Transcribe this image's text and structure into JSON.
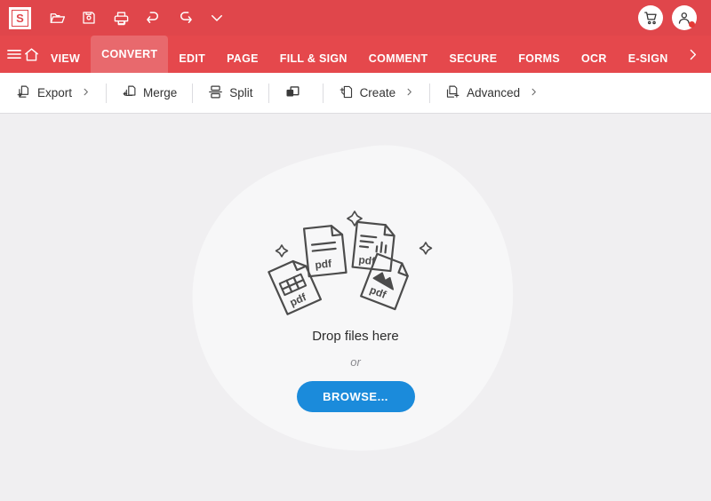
{
  "app": {
    "logo_letter": "S",
    "brand_red": "#e0464b",
    "nav_red": "#e5484c",
    "active_tab_red": "#e8696d",
    "accent_blue": "#1b8bdb",
    "canvas_bg": "#f0eff1",
    "blob_fill": "#f7f7f8"
  },
  "topbar": {
    "icons": [
      {
        "name": "open-folder-icon",
        "label": "Open"
      },
      {
        "name": "save-icon",
        "label": "Save"
      },
      {
        "name": "print-icon",
        "label": "Print"
      },
      {
        "name": "undo-icon",
        "label": "Undo"
      },
      {
        "name": "redo-icon",
        "label": "Redo"
      },
      {
        "name": "chevron-down-icon",
        "label": "More"
      }
    ],
    "right": [
      {
        "name": "cart-icon",
        "label": "Cart",
        "badge": false
      },
      {
        "name": "account-icon",
        "label": "Account",
        "badge": true
      }
    ]
  },
  "nav": {
    "menu_icon": "hamburger-menu-icon",
    "home_icon": "home-icon",
    "tabs": [
      {
        "label": "VIEW",
        "active": false
      },
      {
        "label": "CONVERT",
        "active": true
      },
      {
        "label": "EDIT",
        "active": false
      },
      {
        "label": "PAGE",
        "active": false
      },
      {
        "label": "FILL & SIGN",
        "active": false
      },
      {
        "label": "COMMENT",
        "active": false
      },
      {
        "label": "SECURE",
        "active": false
      },
      {
        "label": "FORMS",
        "active": false
      },
      {
        "label": "OCR",
        "active": false
      },
      {
        "label": "E-SIGN",
        "active": false
      }
    ],
    "overflow_icon": "chevron-right-icon",
    "help_icon": "help-circle-icon",
    "settings_icon": "gear-icon"
  },
  "toolbar": {
    "items": [
      {
        "label": "Export",
        "icon": "export-icon",
        "has_chevron": true
      },
      {
        "label": "Merge",
        "icon": "merge-icon",
        "has_chevron": false
      },
      {
        "label": "Split",
        "icon": "split-icon",
        "has_chevron": false
      },
      {
        "label": "",
        "icon": "overlap-squares-icon",
        "has_chevron": false
      },
      {
        "label": "Create",
        "icon": "create-icon",
        "has_chevron": true
      },
      {
        "label": "Advanced",
        "icon": "advanced-icon",
        "has_chevron": true
      }
    ]
  },
  "dropzone": {
    "title": "Drop files here",
    "or_text": "or",
    "browse_label": "BROWSE...",
    "file_label": "pdf",
    "illustration": "scattered-pdf-documents"
  }
}
